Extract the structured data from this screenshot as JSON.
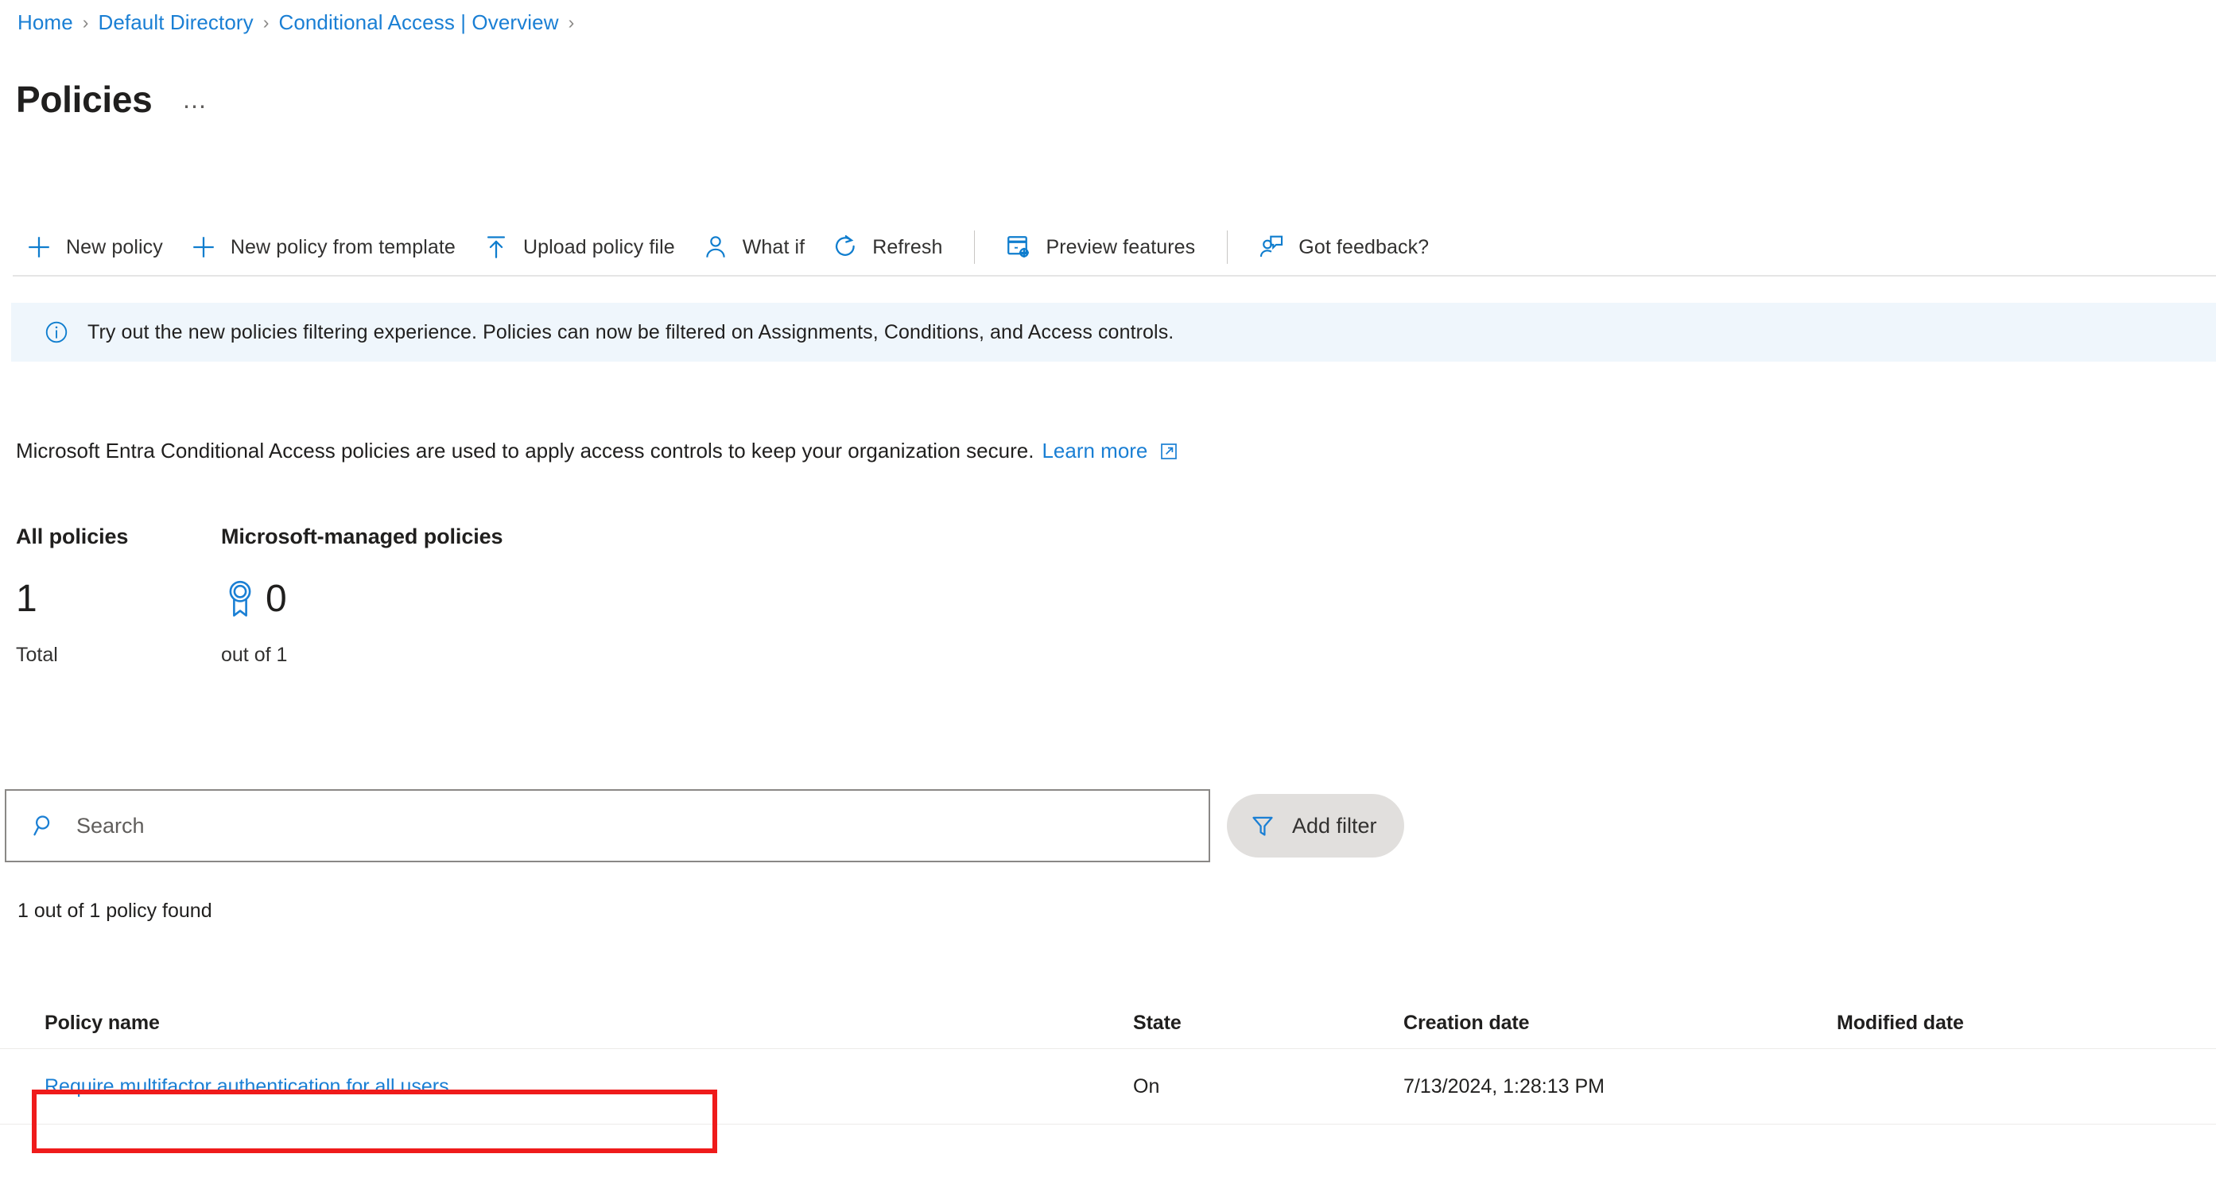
{
  "breadcrumb": {
    "items": [
      {
        "label": "Home"
      },
      {
        "label": "Default Directory"
      },
      {
        "label": "Conditional Access | Overview"
      }
    ],
    "separator": "›"
  },
  "header": {
    "title": "Policies",
    "more_label": "⋯"
  },
  "toolbar": {
    "buttons": [
      {
        "label": "New policy",
        "icon": "plus-icon"
      },
      {
        "label": "New policy from template",
        "icon": "plus-icon"
      },
      {
        "label": "Upload policy file",
        "icon": "upload-icon"
      },
      {
        "label": "What if",
        "icon": "person-icon"
      },
      {
        "label": "Refresh",
        "icon": "refresh-icon"
      },
      {
        "label": "Preview features",
        "icon": "preview-features-icon"
      },
      {
        "label": "Got feedback?",
        "icon": "feedback-icon"
      }
    ]
  },
  "info_banner": {
    "icon": "info-circle-icon",
    "text": "Try out the new policies filtering experience. Policies can now be filtered on Assignments, Conditions, and Access controls."
  },
  "description": {
    "text": "Microsoft Entra Conditional Access policies are used to apply access controls to keep your organization secure.",
    "link_label": "Learn more",
    "link_icon": "external-link-icon"
  },
  "stats": {
    "all_policies": {
      "heading": "All policies",
      "value": "1",
      "sub": "Total"
    },
    "microsoft_managed": {
      "heading": "Microsoft-managed policies",
      "icon": "award-badge-icon",
      "value": "0",
      "sub": "out of 1"
    }
  },
  "search": {
    "placeholder": "Search",
    "value": "",
    "icon": "search-icon"
  },
  "filter": {
    "label": "Add filter",
    "icon": "funnel-icon"
  },
  "result_count": "1 out of 1 policy found",
  "table": {
    "columns": [
      "Policy name",
      "State",
      "Creation date",
      "Modified date"
    ],
    "rows": [
      {
        "name": "Require multifactor authentication for all users",
        "state": "On",
        "creation_date": "7/13/2024, 1:28:13 PM",
        "modified_date": ""
      }
    ]
  },
  "annotation": {
    "color": "#ef1b1b",
    "target": "policy-name-link"
  },
  "colors": {
    "link": "#1a7fd4",
    "accent": "#0078d4",
    "banner_bg": "#eff6fc",
    "filter_pill": "#e1dfdd",
    "text": "#201f1e",
    "annotation_red": "#ef1b1b"
  }
}
